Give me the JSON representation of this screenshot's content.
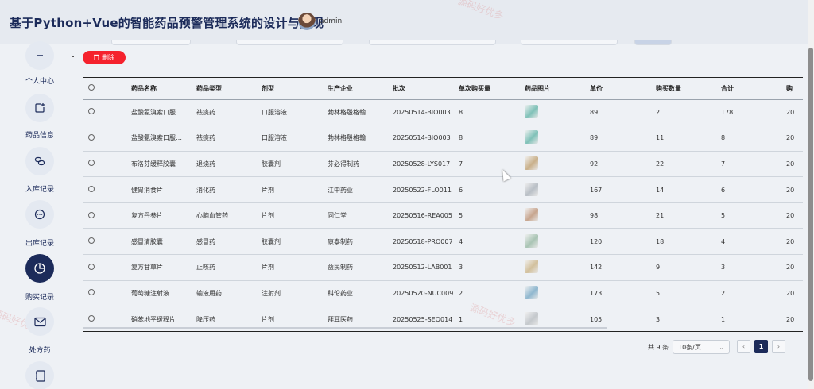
{
  "header": {
    "title": "基于Python+Vue的智能药品预警管理系统的设计与实现",
    "username": "admin"
  },
  "watermark": "源码好优多",
  "sidebar": {
    "items": [
      {
        "label": "个人中心",
        "icon": "user-icon",
        "active": false
      },
      {
        "label": "药品信息",
        "icon": "box-plus-icon",
        "active": false
      },
      {
        "label": "入库记录",
        "icon": "link-icon",
        "active": false
      },
      {
        "label": "出库记录",
        "icon": "chat-bubble-icon",
        "active": false
      },
      {
        "label": "购买记录",
        "icon": "pie-chart-icon",
        "active": true
      },
      {
        "label": "处方药",
        "icon": "mail-icon",
        "active": false
      },
      {
        "label": "",
        "icon": "notebook-icon",
        "active": false
      }
    ]
  },
  "toolbar": {
    "delete_label": "删除"
  },
  "table": {
    "columns": [
      "药品名称",
      "药品类型",
      "剂型",
      "生产企业",
      "批次",
      "单次购买量",
      "药品图片",
      "单价",
      "购买数量",
      "合计",
      "购"
    ],
    "rows": [
      {
        "name": "盐酸氨溴索口服…",
        "type": "祛痰药",
        "form": "口服溶液",
        "maker": "勃林格殷格翰",
        "batch": "20250514-BIO003",
        "single": "8",
        "img": "#7fc1b8",
        "price": "89",
        "qty": "2",
        "total": "178",
        "extra": "20"
      },
      {
        "name": "盐酸氨溴索口服…",
        "type": "祛痰药",
        "form": "口服溶液",
        "maker": "勃林格殷格翰",
        "batch": "20250514-BIO003",
        "single": "8",
        "img": "#7fc1b8",
        "price": "89",
        "qty": "11",
        "total": "8",
        "extra": "20"
      },
      {
        "name": "布洛芬缓释胶囊",
        "type": "退烧药",
        "form": "胶囊剂",
        "maker": "芬必得制药",
        "batch": "20250528-LYS017",
        "single": "7",
        "img": "#c9b08a",
        "price": "92",
        "qty": "22",
        "total": "7",
        "extra": "20"
      },
      {
        "name": "健胃消食片",
        "type": "消化药",
        "form": "片剂",
        "maker": "江中药业",
        "batch": "20250522-FLO011",
        "single": "6",
        "img": "#b9bfc6",
        "price": "167",
        "qty": "14",
        "total": "6",
        "extra": "20"
      },
      {
        "name": "复方丹参片",
        "type": "心脑血管药",
        "form": "片剂",
        "maker": "同仁堂",
        "batch": "20250516-REA005",
        "single": "5",
        "img": "#c7a58e",
        "price": "98",
        "qty": "21",
        "total": "5",
        "extra": "20"
      },
      {
        "name": "感冒清胶囊",
        "type": "感冒药",
        "form": "胶囊剂",
        "maker": "康泰制药",
        "batch": "20250518-PRO007",
        "single": "4",
        "img": "#a9c4b4",
        "price": "120",
        "qty": "18",
        "total": "4",
        "extra": "20"
      },
      {
        "name": "复方甘草片",
        "type": "止咳药",
        "form": "片剂",
        "maker": "益民制药",
        "batch": "20250512-LAB001",
        "single": "3",
        "img": "#d2c09c",
        "price": "142",
        "qty": "9",
        "total": "3",
        "extra": "20"
      },
      {
        "name": "葡萄糖注射液",
        "type": "输液用药",
        "form": "注射剂",
        "maker": "科伦药业",
        "batch": "20250520-NUC009",
        "single": "2",
        "img": "#8fb7cf",
        "price": "173",
        "qty": "5",
        "total": "2",
        "extra": "20"
      },
      {
        "name": "硝苯地平缓释片",
        "type": "降压药",
        "form": "片剂",
        "maker": "拜耳医药",
        "batch": "20250525-SEQ014",
        "single": "1",
        "img": "#c4c8cc",
        "price": "105",
        "qty": "3",
        "total": "1",
        "extra": "20"
      }
    ]
  },
  "pagination": {
    "total_text": "共 9 条",
    "page_size": "10条/页",
    "current_page": "1",
    "prev": "‹",
    "next": "›"
  }
}
